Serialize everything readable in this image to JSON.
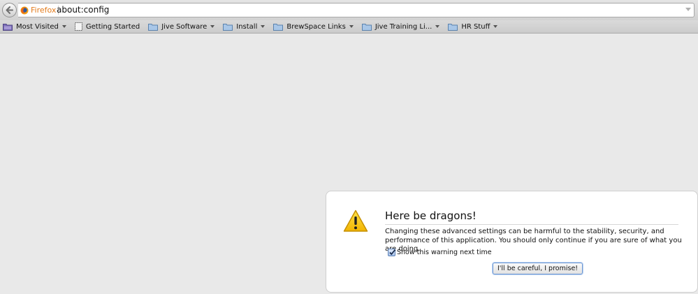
{
  "urlbar": {
    "identity_label": "Firefox",
    "url": "about:config"
  },
  "bookmarks": [
    {
      "label": "Most Visited",
      "icon": "smart-folder-icon",
      "dropdown": true
    },
    {
      "label": "Getting Started",
      "icon": "page-icon",
      "dropdown": false
    },
    {
      "label": "Jive Software",
      "icon": "folder-icon",
      "dropdown": true
    },
    {
      "label": "Install",
      "icon": "folder-icon",
      "dropdown": true
    },
    {
      "label": "BrewSpace Links",
      "icon": "folder-icon",
      "dropdown": true
    },
    {
      "label": "Jive Training Li...",
      "icon": "folder-icon",
      "dropdown": true
    },
    {
      "label": "HR Stuff",
      "icon": "folder-icon",
      "dropdown": true
    }
  ],
  "warning": {
    "title": "Here be dragons!",
    "message": "Changing these advanced settings can be harmful to the stability, security, and performance of this application. You should only continue if you are sure of what you are doing.",
    "checkbox_label": "Show this warning next time",
    "checkbox_checked": true,
    "button_label": "I'll be careful, I promise!"
  },
  "colors": {
    "identity_orange": "#e37b1c",
    "warning_yellow": "#f5c400",
    "background": "#e9e9e9"
  }
}
